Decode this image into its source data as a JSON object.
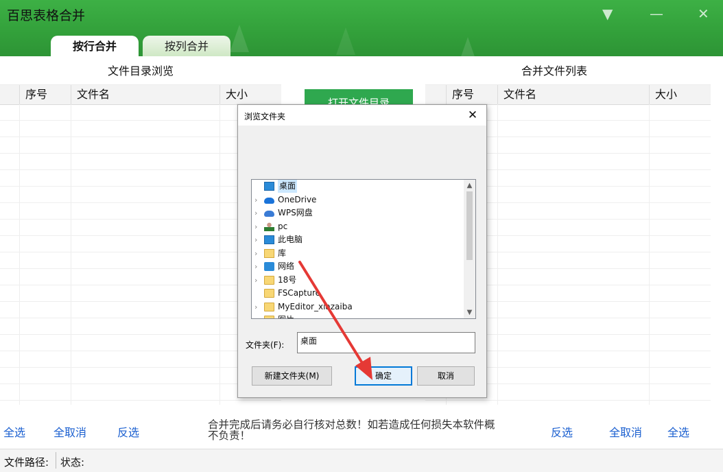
{
  "app": {
    "title": "百思表格合并"
  },
  "window_controls": {
    "menu": "▼",
    "minimize": "—",
    "close": "✕"
  },
  "tabs": [
    {
      "label": "按行合并",
      "active": true
    },
    {
      "label": "按列合并",
      "active": false
    }
  ],
  "left_panel": {
    "title": "文件目录浏览",
    "columns": [
      "序号",
      "文件名",
      "大小"
    ]
  },
  "right_panel": {
    "title": "合并文件列表",
    "columns": [
      "序号",
      "文件名",
      "大小"
    ]
  },
  "open_dir_button": "打开文件目录",
  "bottom": {
    "left_links": [
      "全选",
      "全取消",
      "反选"
    ],
    "right_links": [
      "反选",
      "全取消",
      "全选"
    ],
    "notice": "合并完成后请务必自行核对总数！如若造成任何损失本软件概不负责！"
  },
  "statusbar": {
    "path_label": "文件路径:",
    "status_label": "状态:"
  },
  "dialog": {
    "title": "浏览文件夹",
    "close_glyph": "✕",
    "tree": [
      {
        "label": "桌面",
        "icon": "desktop-icon",
        "selected": true,
        "expandable": false
      },
      {
        "label": "OneDrive",
        "icon": "onedrive-icon",
        "selected": false,
        "expandable": true
      },
      {
        "label": "WPS网盘",
        "icon": "wps-cloud-icon",
        "selected": false,
        "expandable": true
      },
      {
        "label": "pc",
        "icon": "user-icon",
        "selected": false,
        "expandable": true
      },
      {
        "label": "此电脑",
        "icon": "computer-icon",
        "selected": false,
        "expandable": true
      },
      {
        "label": "库",
        "icon": "library-icon",
        "selected": false,
        "expandable": true
      },
      {
        "label": "网络",
        "icon": "network-icon",
        "selected": false,
        "expandable": true
      },
      {
        "label": "18号",
        "icon": "folder-icon",
        "selected": false,
        "expandable": true
      },
      {
        "label": "FSCapture",
        "icon": "folder-icon",
        "selected": false,
        "expandable": false
      },
      {
        "label": "MyEditor_xiazaiba",
        "icon": "folder-icon",
        "selected": false,
        "expandable": true
      },
      {
        "label": "图片",
        "icon": "folder-icon",
        "selected": false,
        "expandable": true
      }
    ],
    "folder_label": "文件夹(F):",
    "folder_value": "桌面",
    "buttons": {
      "new_folder": "新建文件夹(M)",
      "ok": "确定",
      "cancel": "取消"
    }
  },
  "colors": {
    "brand_green": "#33a13b",
    "link_blue": "#1a5fd0",
    "annotation_red": "#e53935"
  }
}
